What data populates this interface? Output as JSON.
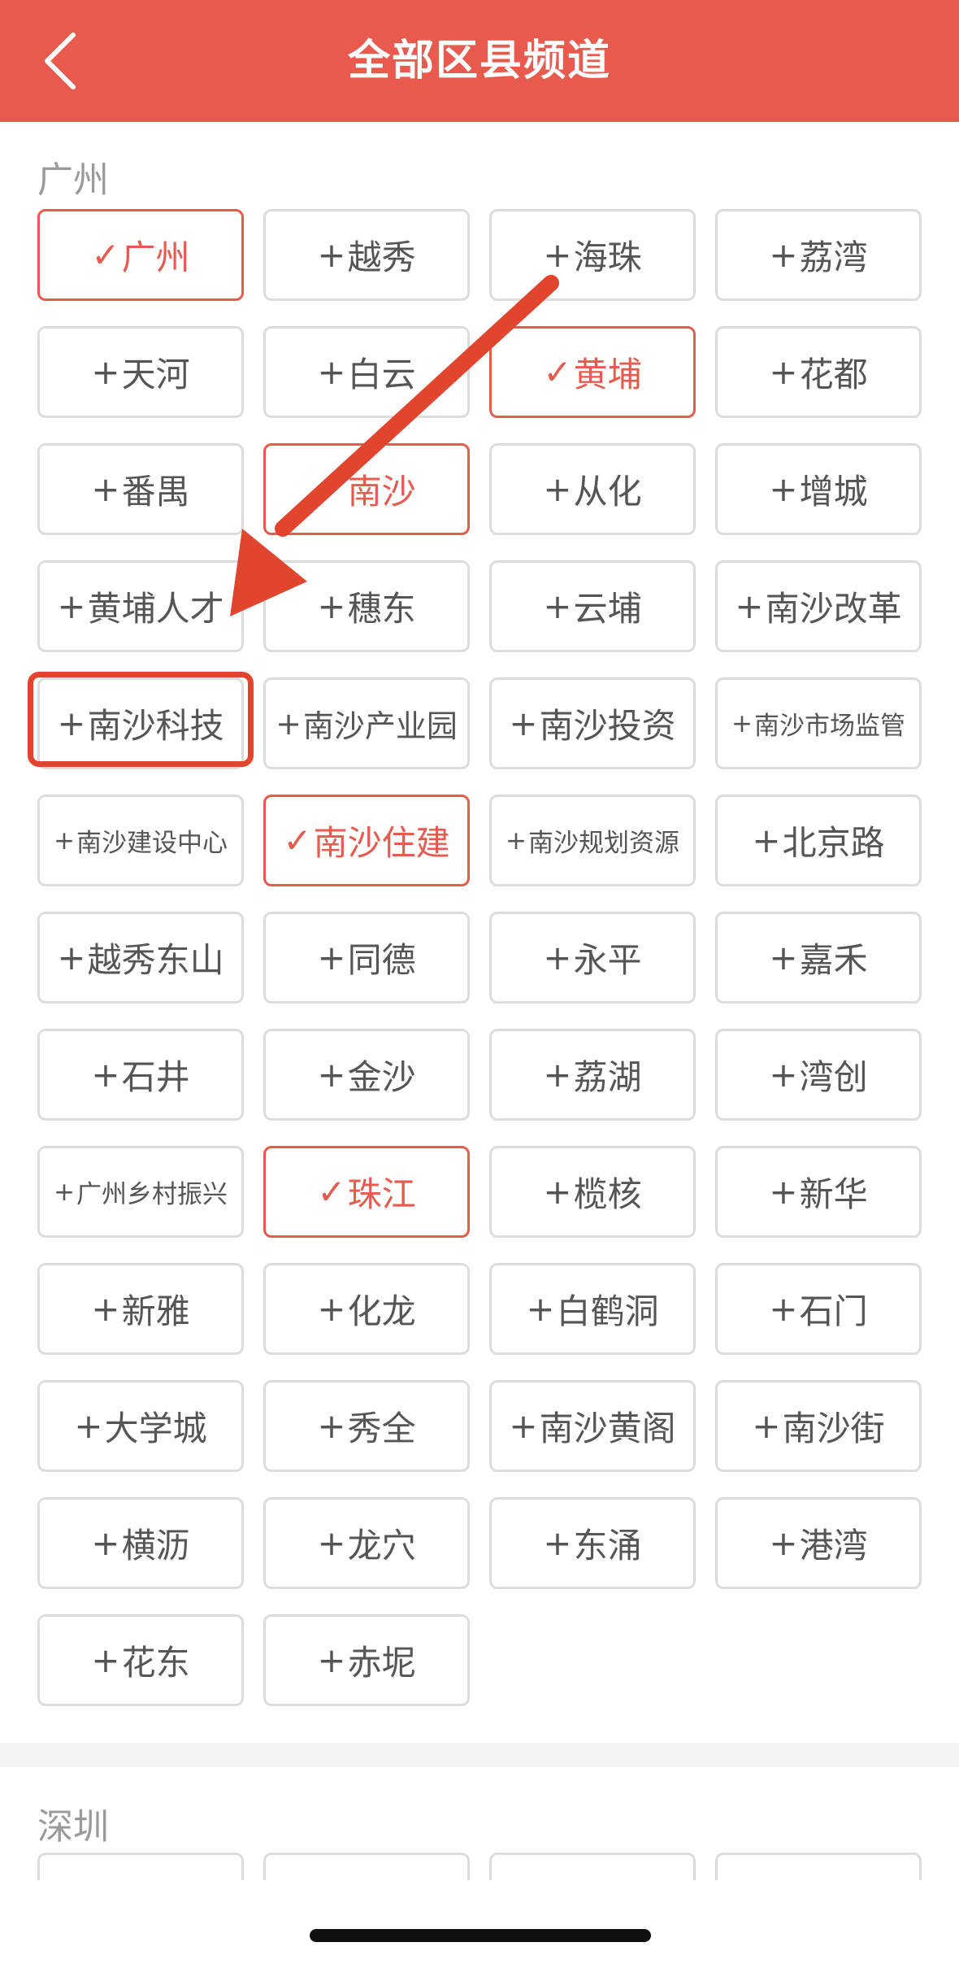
{
  "header": {
    "title": "全部区县频道"
  },
  "sections": [
    {
      "title": "广州",
      "items": [
        {
          "label": "广州",
          "selected": true
        },
        {
          "label": "越秀",
          "selected": false
        },
        {
          "label": "海珠",
          "selected": false
        },
        {
          "label": "荔湾",
          "selected": false
        },
        {
          "label": "天河",
          "selected": false
        },
        {
          "label": "白云",
          "selected": false
        },
        {
          "label": "黄埔",
          "selected": true
        },
        {
          "label": "花都",
          "selected": false
        },
        {
          "label": "番禺",
          "selected": false
        },
        {
          "label": "南沙",
          "selected": true
        },
        {
          "label": "从化",
          "selected": false
        },
        {
          "label": "增城",
          "selected": false
        },
        {
          "label": "黄埔人才",
          "selected": false
        },
        {
          "label": "穗东",
          "selected": false
        },
        {
          "label": "云埔",
          "selected": false
        },
        {
          "label": "南沙改革",
          "selected": false
        },
        {
          "label": "南沙科技",
          "selected": false
        },
        {
          "label": "南沙产业园",
          "selected": false
        },
        {
          "label": "南沙投资",
          "selected": false
        },
        {
          "label": "南沙市场监管",
          "selected": false
        },
        {
          "label": "南沙建设中心",
          "selected": false
        },
        {
          "label": "南沙住建",
          "selected": true
        },
        {
          "label": "南沙规划资源",
          "selected": false
        },
        {
          "label": "北京路",
          "selected": false
        },
        {
          "label": "越秀东山",
          "selected": false
        },
        {
          "label": "同德",
          "selected": false
        },
        {
          "label": "永平",
          "selected": false
        },
        {
          "label": "嘉禾",
          "selected": false
        },
        {
          "label": "石井",
          "selected": false
        },
        {
          "label": "金沙",
          "selected": false
        },
        {
          "label": "荔湖",
          "selected": false
        },
        {
          "label": "湾创",
          "selected": false
        },
        {
          "label": "广州乡村振兴",
          "selected": false
        },
        {
          "label": "珠江",
          "selected": true
        },
        {
          "label": "榄核",
          "selected": false
        },
        {
          "label": "新华",
          "selected": false
        },
        {
          "label": "新雅",
          "selected": false
        },
        {
          "label": "化龙",
          "selected": false
        },
        {
          "label": "白鹤洞",
          "selected": false
        },
        {
          "label": "石门",
          "selected": false
        },
        {
          "label": "大学城",
          "selected": false
        },
        {
          "label": "秀全",
          "selected": false
        },
        {
          "label": "南沙黄阁",
          "selected": false
        },
        {
          "label": "南沙街",
          "selected": false
        },
        {
          "label": "横沥",
          "selected": false
        },
        {
          "label": "龙穴",
          "selected": false
        },
        {
          "label": "东涌",
          "selected": false
        },
        {
          "label": "港湾",
          "selected": false
        },
        {
          "label": "花东",
          "selected": false
        },
        {
          "label": "赤坭",
          "selected": false
        }
      ]
    },
    {
      "title": "深圳",
      "items": []
    }
  ],
  "marks": {
    "add": "+",
    "selected": "✓"
  },
  "colors": {
    "header_bg": "#E8594E",
    "selected": "#E8594E",
    "annotation": "#E2452E"
  },
  "icons": {
    "back": "chevron-left-icon"
  }
}
